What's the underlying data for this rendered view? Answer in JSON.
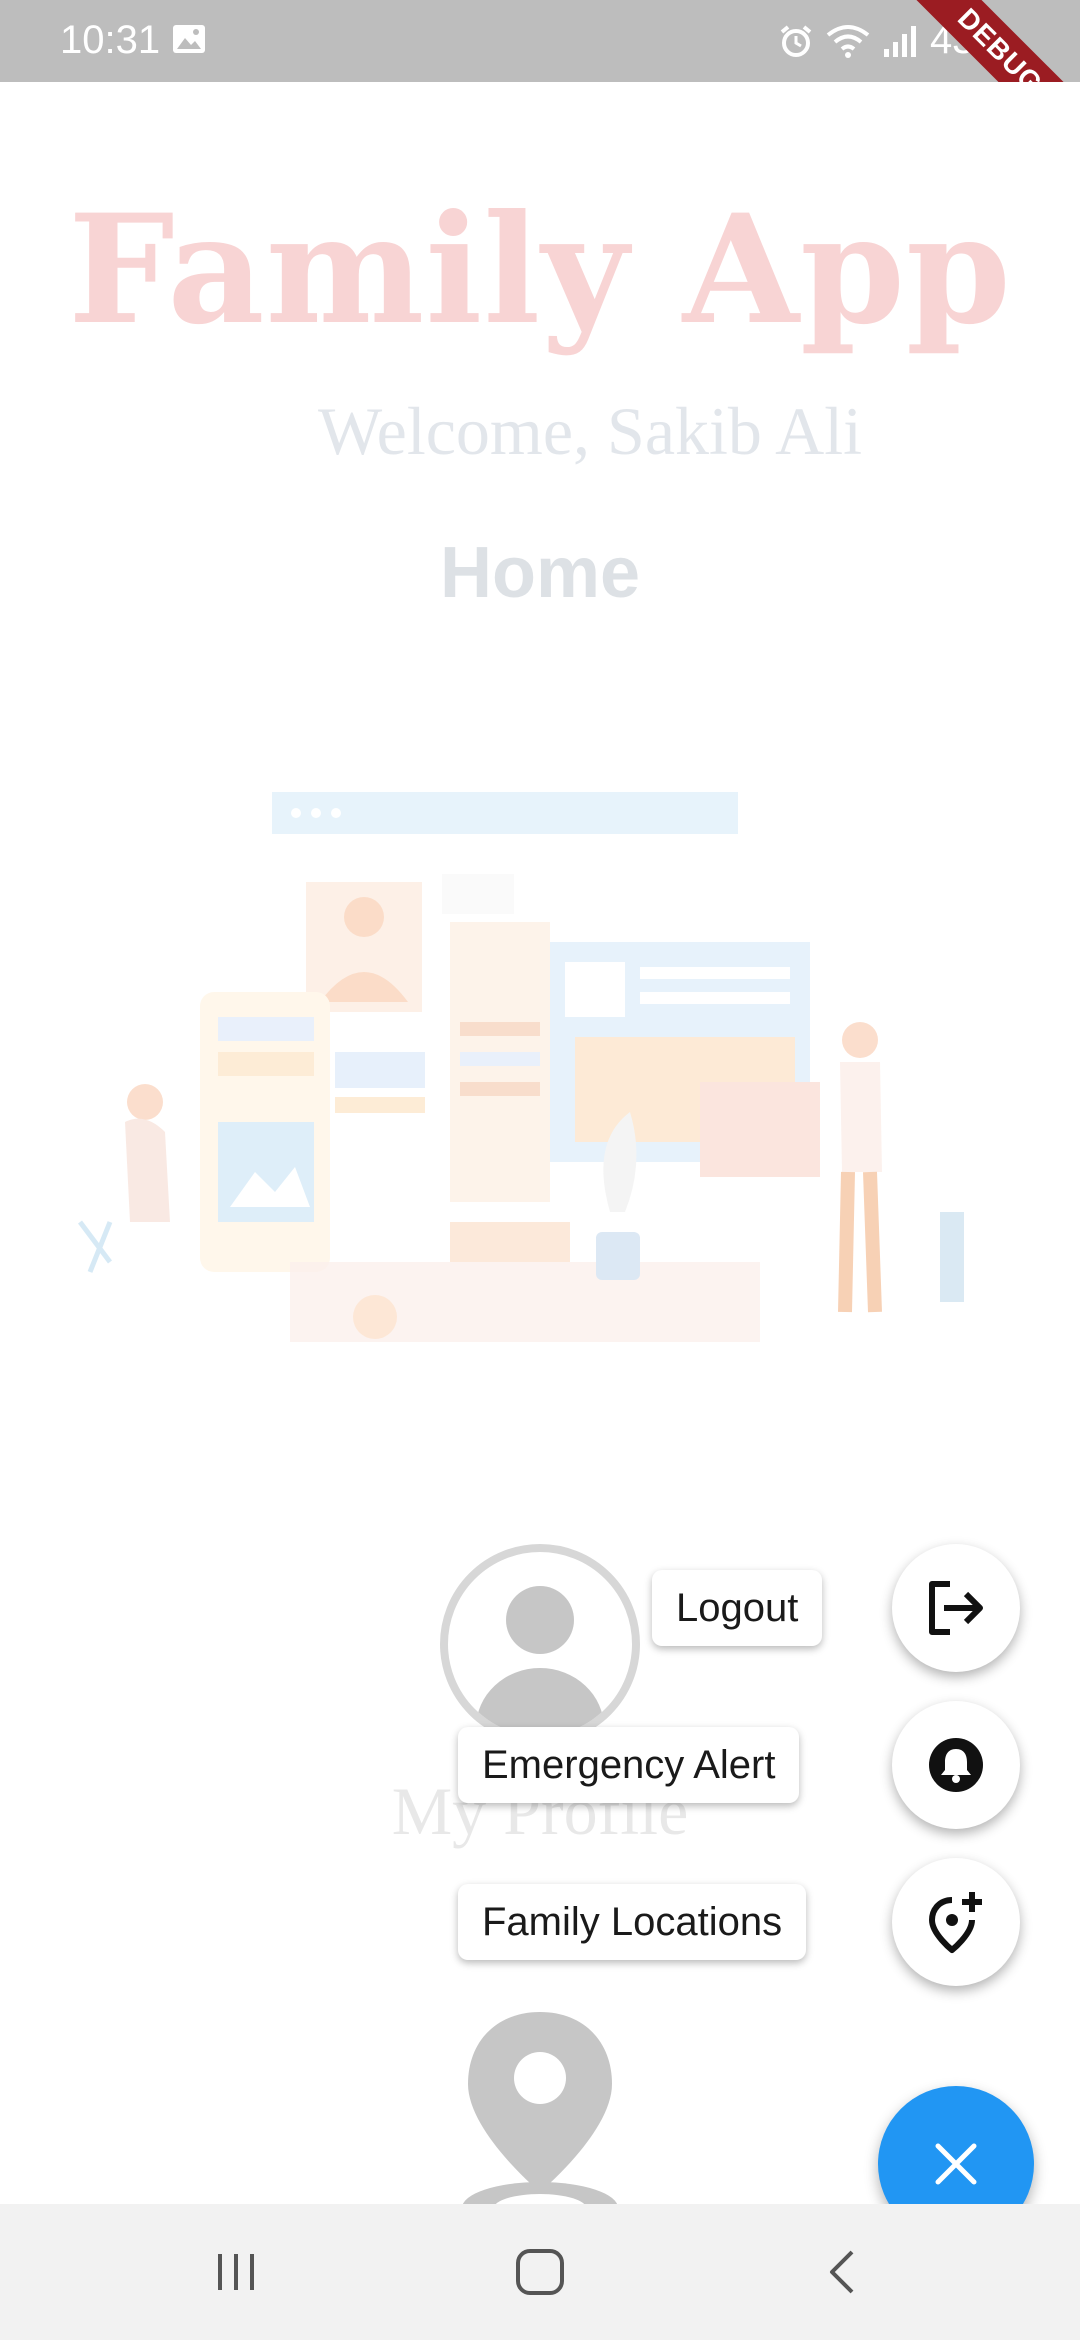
{
  "status_bar": {
    "time": "10:31",
    "battery": "43%",
    "icons": [
      "image-icon",
      "alarm-icon",
      "wifi-icon",
      "signal-icon",
      "battery-icon"
    ],
    "debug_banner": "DEBUG"
  },
  "header": {
    "app_title": "Family App",
    "welcome": "Welcome, Sakib Ali",
    "page_title": "Home"
  },
  "main": {
    "illustration": "workspace-illustration",
    "profile_label": "My Profile"
  },
  "speed_dial": {
    "actions": [
      {
        "label": "Logout",
        "icon": "logout-icon"
      },
      {
        "label": "Emergency Alert",
        "icon": "bell-icon"
      },
      {
        "label": "Family Locations",
        "icon": "add-location-icon"
      }
    ],
    "close_icon": "close-icon",
    "fab_color": "#2196f3"
  },
  "nav_bar": {
    "buttons": [
      "recents-icon",
      "home-icon",
      "back-icon"
    ]
  },
  "colors": {
    "title": "#f8d4d4",
    "status_bar": "#bdbdbd",
    "ribbon": "#9b1c22"
  }
}
